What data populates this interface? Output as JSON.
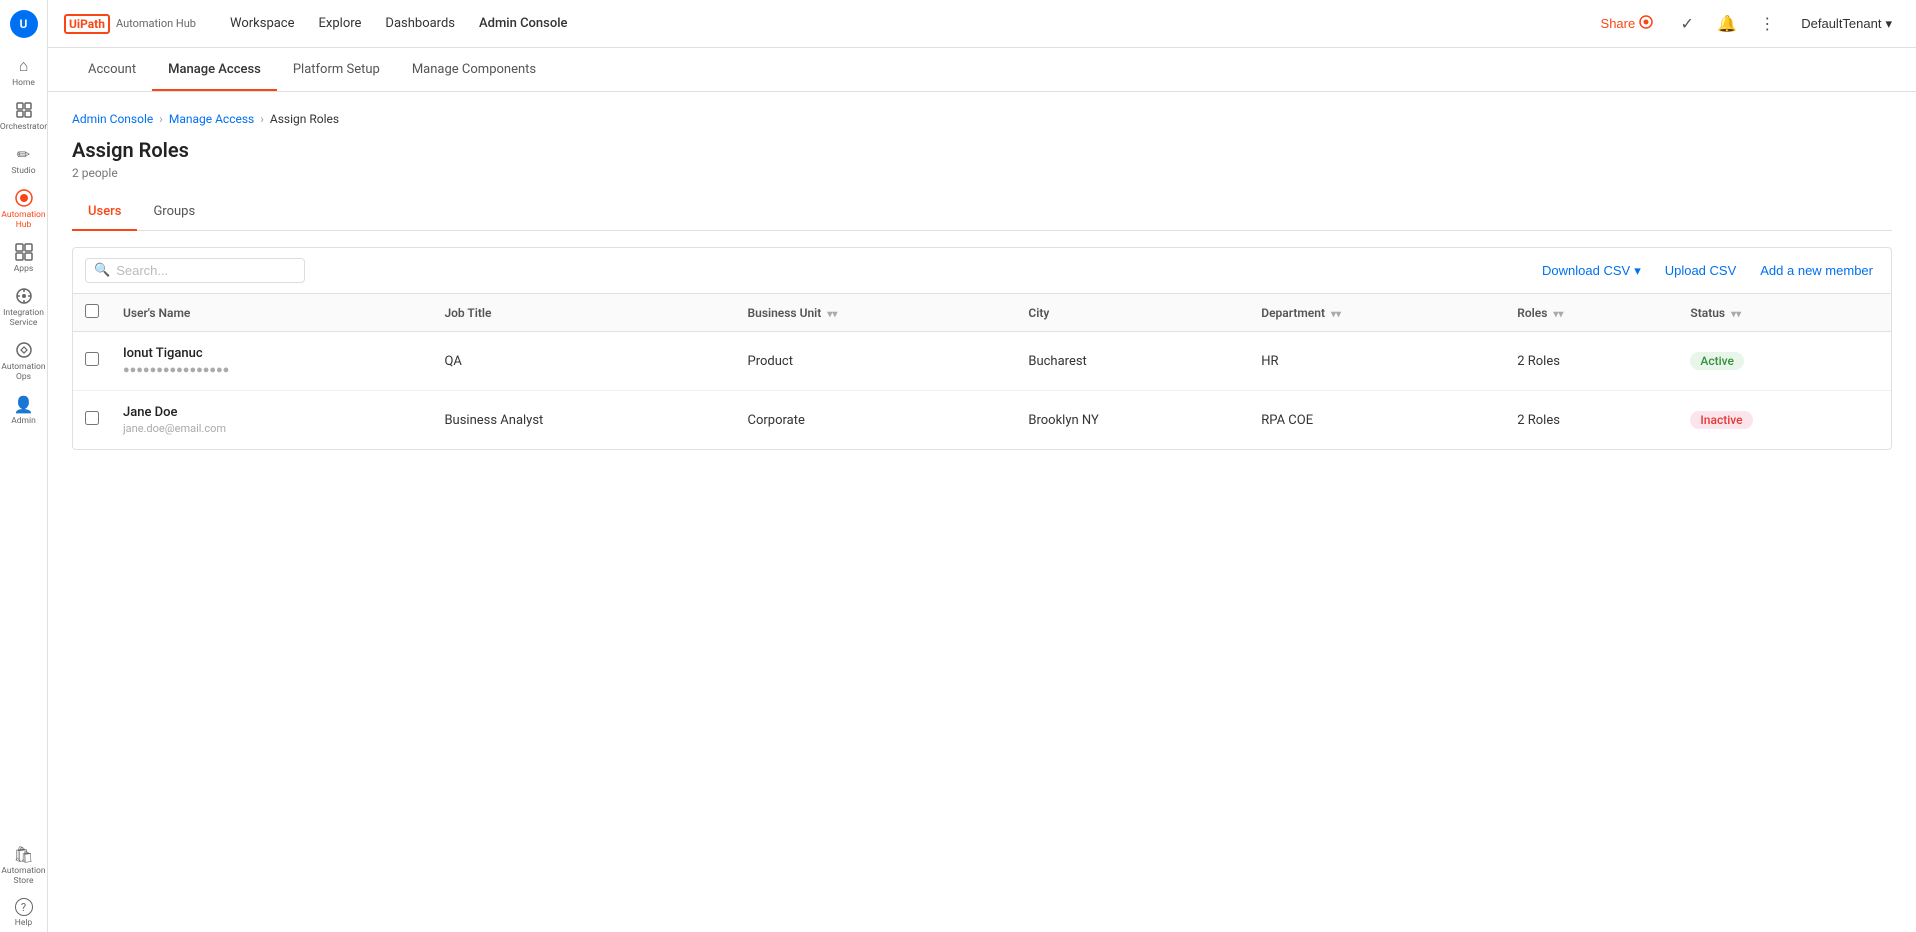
{
  "logo": {
    "brand": "UiPath",
    "product": "Automation Hub"
  },
  "topnav": {
    "links": [
      {
        "id": "workspace",
        "label": "Workspace"
      },
      {
        "id": "explore",
        "label": "Explore"
      },
      {
        "id": "dashboards",
        "label": "Dashboards"
      },
      {
        "id": "admin-console",
        "label": "Admin Console"
      }
    ],
    "share_label": "Share",
    "tenant_label": "DefaultTenant"
  },
  "subnav": {
    "tabs": [
      {
        "id": "account",
        "label": "Account"
      },
      {
        "id": "manage-access",
        "label": "Manage Access",
        "active": true
      },
      {
        "id": "platform-setup",
        "label": "Platform Setup"
      },
      {
        "id": "manage-components",
        "label": "Manage Components"
      }
    ]
  },
  "breadcrumb": {
    "items": [
      {
        "label": "Admin Console",
        "link": true
      },
      {
        "label": "Manage Access",
        "link": true
      },
      {
        "label": "Assign Roles",
        "link": false
      }
    ]
  },
  "page": {
    "title": "Assign Roles",
    "subtitle": "2 people"
  },
  "inner_tabs": [
    {
      "id": "users",
      "label": "Users",
      "active": true
    },
    {
      "id": "groups",
      "label": "Groups",
      "active": false
    }
  ],
  "toolbar": {
    "search_placeholder": "Search...",
    "download_csv": "Download CSV",
    "upload_csv": "Upload CSV",
    "add_member": "Add a new member"
  },
  "table": {
    "columns": [
      {
        "id": "user-name",
        "label": "User's Name",
        "filterable": false
      },
      {
        "id": "job-title",
        "label": "Job Title",
        "filterable": false
      },
      {
        "id": "business-unit",
        "label": "Business Unit",
        "filterable": true
      },
      {
        "id": "city",
        "label": "City",
        "filterable": false
      },
      {
        "id": "department",
        "label": "Department",
        "filterable": true
      },
      {
        "id": "roles",
        "label": "Roles",
        "filterable": true
      },
      {
        "id": "status",
        "label": "Status",
        "filterable": true
      }
    ],
    "rows": [
      {
        "id": "row-1",
        "name": "Ionut Tiganuc",
        "email": "●●●●●●●●●●●●●●●●",
        "job_title": "QA",
        "business_unit": "Product",
        "city": "Bucharest",
        "department": "HR",
        "roles": "2 Roles",
        "status": "Active",
        "status_type": "active"
      },
      {
        "id": "row-2",
        "name": "Jane Doe",
        "email": "jane.doe@email.com",
        "job_title": "Business Analyst",
        "business_unit": "Corporate",
        "city": "Brooklyn NY",
        "department": "RPA COE",
        "roles": "2 Roles",
        "status": "Inactive",
        "status_type": "inactive"
      }
    ]
  },
  "sidebar": {
    "items": [
      {
        "id": "home",
        "label": "Home",
        "icon": "⌂"
      },
      {
        "id": "orchestrator",
        "label": "Orchestrator",
        "icon": "◈"
      },
      {
        "id": "studio",
        "label": "Studio",
        "icon": "✏"
      },
      {
        "id": "automation-hub",
        "label": "Automation Hub",
        "icon": "◉",
        "active": true
      },
      {
        "id": "apps",
        "label": "Apps",
        "icon": "⊞"
      },
      {
        "id": "integration-service",
        "label": "Integration Service",
        "icon": "⚙"
      },
      {
        "id": "automation-ops",
        "label": "Automation Ops",
        "icon": "⊕"
      },
      {
        "id": "admin",
        "label": "Admin",
        "icon": "👤"
      }
    ],
    "bottom": [
      {
        "id": "automation-store",
        "label": "Automation Store",
        "icon": "🛍"
      },
      {
        "id": "help",
        "label": "Help",
        "icon": "?"
      }
    ]
  },
  "colors": {
    "brand_orange": "#fa4616",
    "link_blue": "#0070f3",
    "active_green_bg": "#e8f5e9",
    "active_green_text": "#388e3c",
    "inactive_red_bg": "#fce4ec",
    "inactive_red_text": "#e53935"
  }
}
